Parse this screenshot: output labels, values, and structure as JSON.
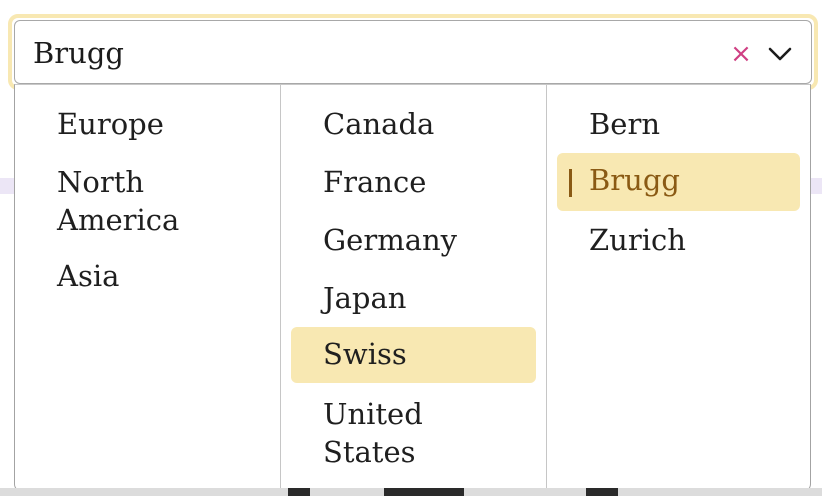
{
  "cascader": {
    "selected_label": "Brugg",
    "clear_icon": "close-icon",
    "expand_icon": "chevron-down-icon",
    "accent_color": "#f8e8b2",
    "active_text_color": "#8a5a14",
    "clear_color": "#cf3f83"
  },
  "columns": [
    {
      "items": [
        {
          "label": "Europe"
        },
        {
          "label": "North\nAmerica"
        },
        {
          "label": "Asia"
        }
      ]
    },
    {
      "items": [
        {
          "label": "Canada"
        },
        {
          "label": "France"
        },
        {
          "label": "Germany"
        },
        {
          "label": "Japan"
        },
        {
          "label": "Swiss"
        },
        {
          "label": "United\nStates"
        }
      ]
    },
    {
      "items": [
        {
          "label": "Bern"
        },
        {
          "label": "Brugg"
        },
        {
          "label": "Zurich"
        }
      ]
    }
  ]
}
